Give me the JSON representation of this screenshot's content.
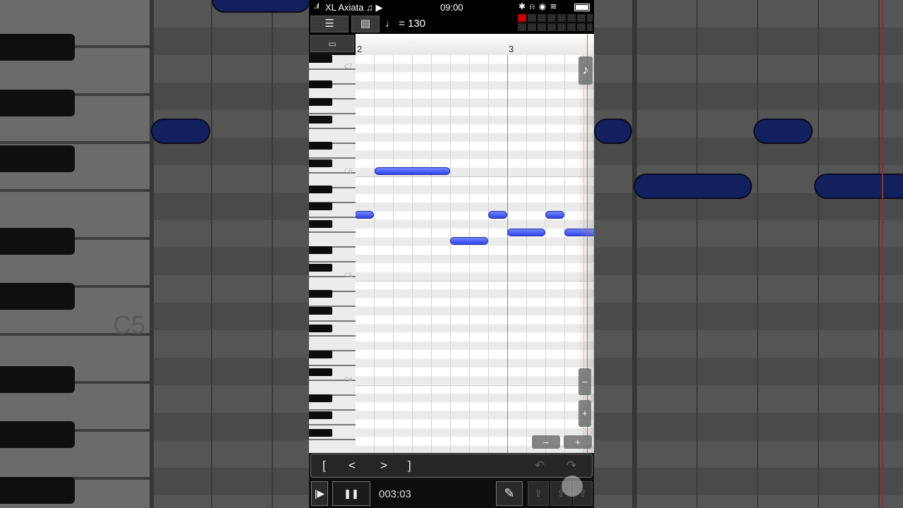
{
  "status_bar": {
    "signal": "..ıl",
    "carrier": "XL Axiata",
    "carrier_icons": "♫ ▶",
    "time": "09:00",
    "right_icons": "✱ ⍾ ◉ ≋"
  },
  "toolbar": {
    "menu_icon": "☰",
    "score_icon": "▤",
    "tempo": "♩ = 130"
  },
  "ruler": {
    "toggle_icon": "▭",
    "bars": [
      "2",
      "3"
    ]
  },
  "keyboard": {
    "labels": [
      "C7",
      "C6",
      "C5",
      "C4"
    ]
  },
  "side_controls": {
    "note_icon": "♪",
    "vzoom_out": "–",
    "vzoom_in": "+",
    "hzoom_out": "–",
    "hzoom_in": "+"
  },
  "nav": {
    "loop_start": "[",
    "prev": "<",
    "next": ">",
    "loop_end": "]",
    "undo": "↶",
    "redo": "↷"
  },
  "transport": {
    "play_from_start": "|▶",
    "pause": "❚❚",
    "time": "003:03",
    "pencil_icon": "✎",
    "export1_icon": "⇪",
    "export2_icon": "⇪",
    "export3_icon": "⇪"
  },
  "background": {
    "label": "C5"
  },
  "colors": {
    "note": "#3a4cf0",
    "playhead": "#e35a5a",
    "meter_active": "#c40000"
  }
}
